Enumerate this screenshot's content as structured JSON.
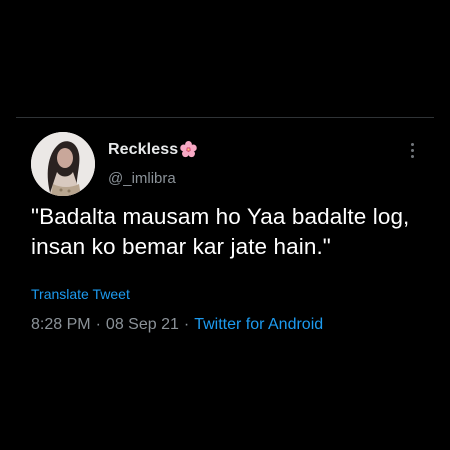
{
  "tweet": {
    "display_name": "Reckless",
    "handle": "@_imlibra",
    "text": "\"Badalta mausam ho Yaa badalte log, insan ko bemar kar jate hain.\"",
    "translate_label": "Translate Tweet",
    "time": "8:28 PM",
    "date": "08 Sep 21",
    "separator": "·",
    "source": "Twitter for Android"
  },
  "icons": {
    "name_emoji": "cherry-blossom-icon",
    "more": "more-vertical-icon"
  },
  "colors": {
    "background": "#000000",
    "text_primary": "#e7e9ea",
    "text_secondary": "#8b9298",
    "link": "#1d9bf0",
    "divider": "#2f3336"
  }
}
